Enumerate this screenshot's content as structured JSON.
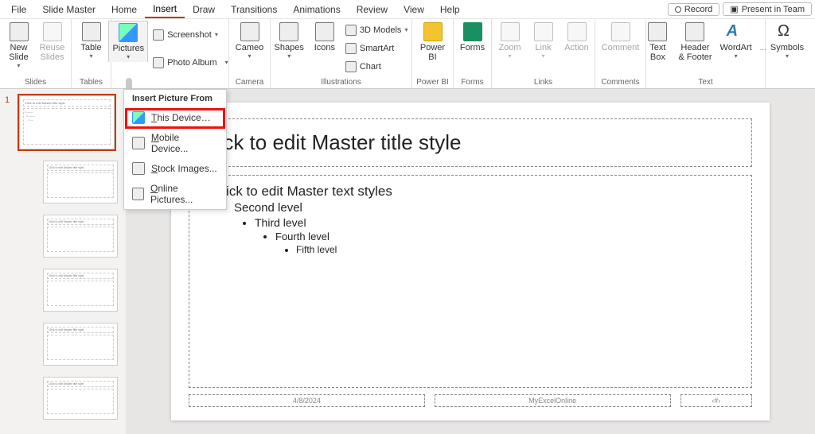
{
  "menubar": {
    "items": [
      "File",
      "Slide Master",
      "Home",
      "Insert",
      "Draw",
      "Transitions",
      "Animations",
      "Review",
      "View",
      "Help"
    ],
    "active": "Insert",
    "record": "Record",
    "present": "Present in Team"
  },
  "ribbon": {
    "slides": {
      "new_slide": "New\nSlide",
      "reuse": "Reuse\nSlides",
      "group": "Slides"
    },
    "tables": {
      "table": "Table",
      "group": "Tables"
    },
    "images": {
      "pictures": "Pictures",
      "screenshot": "Screenshot",
      "album": "Photo Album"
    },
    "camera": {
      "cameo": "Cameo",
      "group": "Camera"
    },
    "illus": {
      "shapes": "Shapes",
      "icons": "Icons",
      "models": "3D Models",
      "smartart": "SmartArt",
      "chart": "Chart",
      "group": "Illustrations"
    },
    "powerbi": {
      "label": "Power\nBI",
      "group": "Power BI"
    },
    "forms": {
      "label": "Forms",
      "group": "Forms"
    },
    "links": {
      "zoom": "Zoom",
      "link": "Link",
      "action": "Action",
      "group": "Links"
    },
    "comments": {
      "comment": "Comment",
      "group": "Comments"
    },
    "text": {
      "textbox": "Text\nBox",
      "header": "Header\n& Footer",
      "wordart": "WordArt",
      "group": "Text"
    },
    "symbols": {
      "label": "Symbols",
      "group": ""
    }
  },
  "dropdown": {
    "header": "Insert Picture From",
    "items": [
      "This Device…",
      "Mobile Device...",
      "Stock Images...",
      "Online Pictures..."
    ]
  },
  "thumbs": {
    "num": "1",
    "mini_title": "Click to edit Master title style"
  },
  "slide": {
    "title": "Click to edit Master title style",
    "b1": "Click to edit Master text styles",
    "b2": "Second level",
    "b3": "Third level",
    "b4": "Fourth level",
    "b5": "Fifth level",
    "date": "4/8/2024",
    "footer": "MyExcelOnline",
    "pagenum": "‹#›"
  }
}
